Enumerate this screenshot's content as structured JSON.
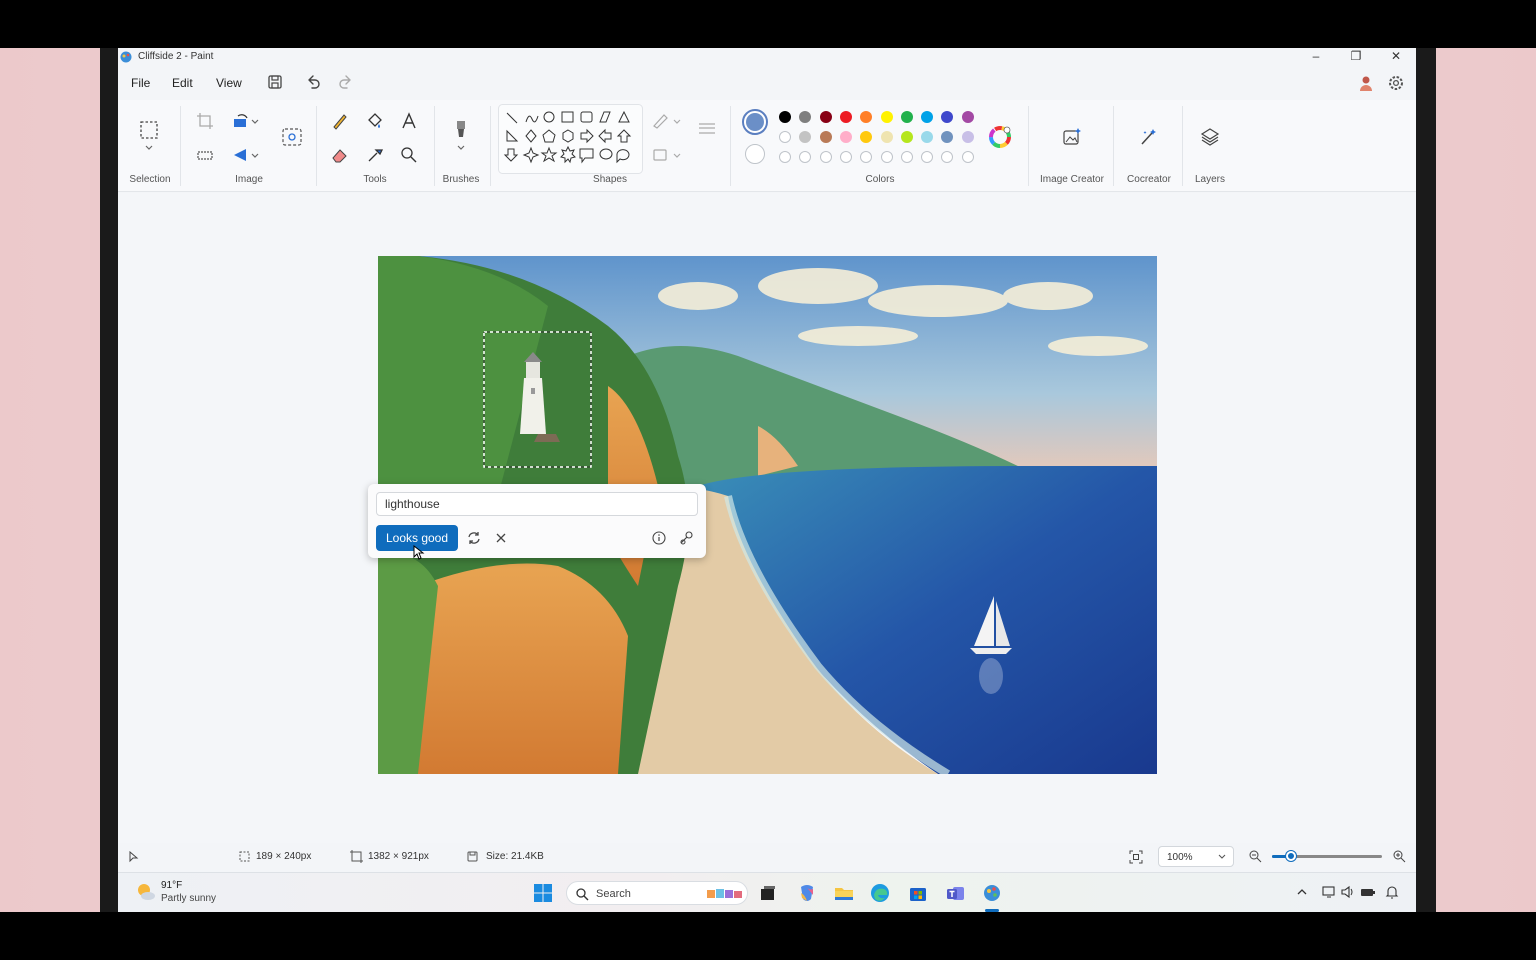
{
  "window": {
    "title": "Cliffside 2 - Paint"
  },
  "menu": {
    "file": "File",
    "edit": "Edit",
    "view": "View"
  },
  "ribbon": {
    "groups": {
      "selection": "Selection",
      "image": "Image",
      "tools": "Tools",
      "brushes": "Brushes",
      "shapes": "Shapes",
      "colors": "Colors",
      "image_creator": "Image Creator",
      "cocreator": "Cocreator",
      "layers": "Layers"
    },
    "palette_row1": [
      "#000000",
      "#7f7f7f",
      "#880015",
      "#ed1c24",
      "#ff7f27",
      "#fff200",
      "#22b14c",
      "#00a2e8",
      "#3f48cc",
      "#a349a4"
    ],
    "palette_row2": [
      "#ffffff",
      "#c3c3c3",
      "#b97a57",
      "#ffaec9",
      "#ffc90e",
      "#efe4b0",
      "#b5e61d",
      "#99d9ea",
      "#7092be",
      "#c8bfe7"
    ],
    "primary_color": "#6b8fc7"
  },
  "prompt": {
    "value": "lighthouse",
    "confirm_label": "Looks good"
  },
  "status": {
    "selection_size": "189 × 240px",
    "canvas_size": "1382 × 921px",
    "file_size": "Size: 21.4KB",
    "zoom": "100%"
  },
  "taskbar": {
    "weather_temp": "91°F",
    "weather_desc": "Partly sunny",
    "search_label": "Search"
  }
}
